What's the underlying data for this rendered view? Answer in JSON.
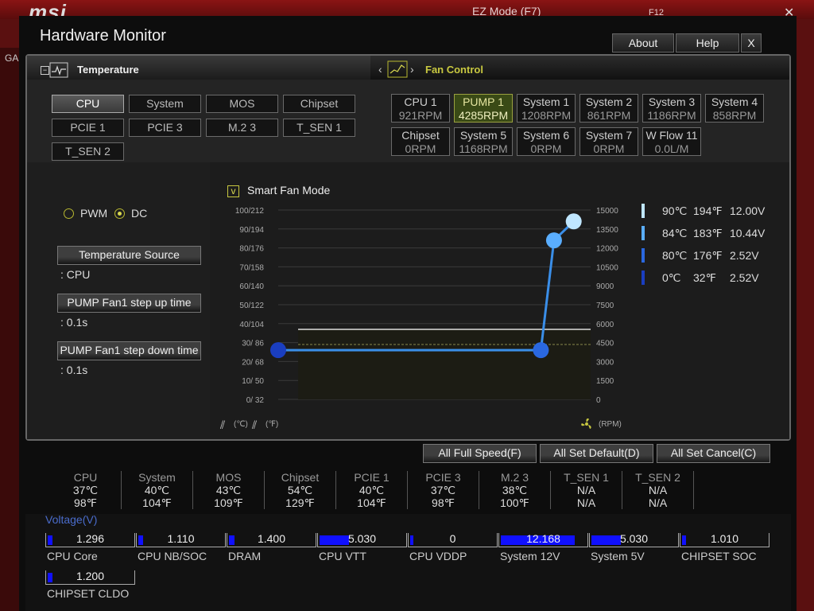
{
  "background": {
    "logo": "msi",
    "ez_mode": "EZ Mode (F7)",
    "f12": "F12",
    "side": "GA"
  },
  "window": {
    "title": "Hardware Monitor",
    "about": "About",
    "help": "Help",
    "close": "X"
  },
  "tabs": {
    "temperature": "Temperature",
    "fan_control": "Fan Control",
    "prev": "‹",
    "next": "›"
  },
  "temp_sources": [
    {
      "label": "CPU",
      "selected": true
    },
    {
      "label": "System"
    },
    {
      "label": "MOS"
    },
    {
      "label": "Chipset"
    },
    {
      "label": "PCIE 1"
    },
    {
      "label": "PCIE 3"
    },
    {
      "label": "M.2 3"
    },
    {
      "label": "T_SEN 1"
    },
    {
      "label": "T_SEN 2"
    }
  ],
  "fans": [
    {
      "name": "CPU 1",
      "value": "921RPM"
    },
    {
      "name": "PUMP 1",
      "value": "4285RPM",
      "selected": true
    },
    {
      "name": "System 1",
      "value": "1208RPM"
    },
    {
      "name": "System 2",
      "value": "861RPM"
    },
    {
      "name": "System 3",
      "value": "1186RPM"
    },
    {
      "name": "System 4",
      "value": "858RPM"
    },
    {
      "name": "Chipset",
      "value": "0RPM"
    },
    {
      "name": "System 5",
      "value": "1168RPM"
    },
    {
      "name": "System 6",
      "value": "0RPM"
    },
    {
      "name": "System 7",
      "value": "0RPM"
    },
    {
      "name": "W Flow 11",
      "value": "0.0L/M"
    }
  ],
  "mode": {
    "pwm": "PWM",
    "dc": "DC",
    "selected": "DC"
  },
  "settings": {
    "temp_source_label": "Temperature Source",
    "temp_source_value": ": CPU",
    "step_up_label": "PUMP Fan1 step up time",
    "step_up_value": ": 0.1s",
    "step_down_label": "PUMP Fan1 step down time",
    "step_down_value": ": 0.1s"
  },
  "smart_fan": {
    "label": "Smart Fan Mode",
    "checked": true
  },
  "axis": {
    "left": [
      "100/212",
      "90/194",
      "80/176",
      "70/158",
      "60/140",
      "50/122",
      "40/104",
      "30/ 86",
      "20/ 68",
      "10/ 50",
      "0/ 32"
    ],
    "right": [
      "15000",
      "13500",
      "12000",
      "10500",
      "9000",
      "7500",
      "6000",
      "4500",
      "3000",
      "1500",
      "0"
    ],
    "unit_c": "(℃)",
    "unit_f": "(℉)",
    "unit_rpm": "(RPM)"
  },
  "curve_points": [
    {
      "temp_c": 0,
      "rpm": 3900
    },
    {
      "temp_c": 80,
      "rpm": 3900
    },
    {
      "temp_c": 84,
      "rpm": 12600
    },
    {
      "temp_c": 90,
      "rpm": 14100
    }
  ],
  "legend": [
    {
      "c": "90℃",
      "f": "194℉",
      "v": "12.00V",
      "color": "#bfe6ff"
    },
    {
      "c": "84℃",
      "f": "183℉",
      "v": "10.44V",
      "color": "#5aaeff"
    },
    {
      "c": "80℃",
      "f": "176℉",
      "v": "2.52V",
      "color": "#2a68e0"
    },
    {
      "c": "0℃",
      "f": "32℉",
      "v": "2.52V",
      "color": "#1a3ec0"
    }
  ],
  "actions": {
    "full": "All Full Speed(F)",
    "default": "All Set Default(D)",
    "cancel": "All Set Cancel(C)"
  },
  "temps": [
    {
      "name": "CPU",
      "c": "37℃",
      "f": "98℉"
    },
    {
      "name": "System",
      "c": "40℃",
      "f": "104℉"
    },
    {
      "name": "MOS",
      "c": "43℃",
      "f": "109℉"
    },
    {
      "name": "Chipset",
      "c": "54℃",
      "f": "129℉"
    },
    {
      "name": "PCIE 1",
      "c": "40℃",
      "f": "104℉"
    },
    {
      "name": "PCIE 3",
      "c": "37℃",
      "f": "98℉"
    },
    {
      "name": "M.2 3",
      "c": "38℃",
      "f": "100℉"
    },
    {
      "name": "T_SEN 1",
      "c": "N/A",
      "f": "N/A"
    },
    {
      "name": "T_SEN 2",
      "c": "N/A",
      "f": "N/A"
    }
  ],
  "voltage": {
    "title": "Voltage(V)",
    "items": [
      {
        "name": "CPU Core",
        "value": "1.296",
        "fill": 0.06
      },
      {
        "name": "CPU NB/SOC",
        "value": "1.110",
        "fill": 0.06
      },
      {
        "name": "DRAM",
        "value": "1.400",
        "fill": 0.07
      },
      {
        "name": "CPU VTT",
        "value": "5.030",
        "fill": 0.35
      },
      {
        "name": "CPU VDDP",
        "value": "0",
        "fill": 0
      },
      {
        "name": "System 12V",
        "value": "12.168",
        "fill": 0.88
      },
      {
        "name": "System 5V",
        "value": "5.030",
        "fill": 0.35
      },
      {
        "name": "CHIPSET SOC",
        "value": "1.010",
        "fill": 0.05
      },
      {
        "name": "CHIPSET CLDO",
        "value": "1.200",
        "fill": 0.06
      }
    ]
  }
}
